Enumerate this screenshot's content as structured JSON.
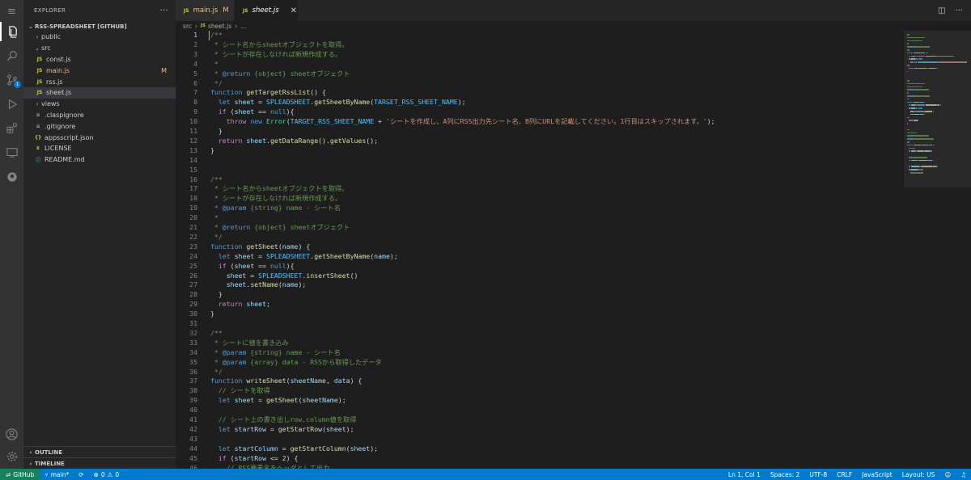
{
  "activity_bar": {
    "icons": [
      "menu-icon",
      "files-icon",
      "search-icon",
      "source-control-icon",
      "run-debug-icon",
      "extensions-icon",
      "remote-explorer-icon",
      "github-icon",
      "account-icon",
      "settings-gear-icon"
    ],
    "source_control_badge": "1"
  },
  "sidebar": {
    "title": "EXPLORER",
    "more_label": "···",
    "root_folder": "RSS-SPREADSHEET [GITHUB]",
    "tree": [
      {
        "label": "public",
        "type": "folder",
        "expanded": false,
        "depth": 0
      },
      {
        "label": "src",
        "type": "folder",
        "expanded": true,
        "depth": 0
      },
      {
        "label": "const.js",
        "type": "js",
        "depth": 1
      },
      {
        "label": "main.js",
        "type": "js",
        "depth": 1,
        "modified": "M"
      },
      {
        "label": "rss.js",
        "type": "js",
        "depth": 1
      },
      {
        "label": "sheet.js",
        "type": "js",
        "depth": 1,
        "selected": true
      },
      {
        "label": "views",
        "type": "folder",
        "expanded": false,
        "depth": 0
      },
      {
        "label": ".claspignore",
        "type": "cfg",
        "depth": 0
      },
      {
        "label": ".gitignore",
        "type": "cfg",
        "depth": 0
      },
      {
        "label": "appsscript.json",
        "type": "json",
        "depth": 0
      },
      {
        "label": "LICENSE",
        "type": "lic",
        "depth": 0
      },
      {
        "label": "README.md",
        "type": "md",
        "depth": 0
      }
    ],
    "outline_label": "OUTLINE",
    "timeline_label": "TIMELINE"
  },
  "tabs": [
    {
      "label": "main.js",
      "badge": "JS",
      "modified": "M",
      "active": false
    },
    {
      "label": "sheet.js",
      "badge": "JS",
      "active": true,
      "close": "✕"
    }
  ],
  "breadcrumb": {
    "folder": "src",
    "file_badge": "JS",
    "file": "sheet.js",
    "tail": "..."
  },
  "editor": {
    "current_line": 1,
    "lines": [
      [
        [
          "cm",
          "/**"
        ]
      ],
      [
        [
          "cm",
          " * シート名からsheetオブジェクトを取得。"
        ]
      ],
      [
        [
          "cm",
          " * シートが存在しなければ新規作成する。"
        ]
      ],
      [
        [
          "cm",
          " *"
        ]
      ],
      [
        [
          "cm",
          " * "
        ],
        [
          "tag",
          "@return"
        ],
        [
          "cm",
          " {object} sheetオブジェクト"
        ]
      ],
      [
        [
          "cm",
          " */"
        ]
      ],
      [
        [
          "kw",
          "function"
        ],
        [
          "p",
          " "
        ],
        [
          "fn",
          "getTargetRssList"
        ],
        [
          "p",
          "() {"
        ]
      ],
      [
        [
          "p",
          "  "
        ],
        [
          "kw",
          "let"
        ],
        [
          "p",
          " "
        ],
        [
          "var",
          "sheet"
        ],
        [
          "p",
          " = "
        ],
        [
          "const",
          "SPLEADSHEET"
        ],
        [
          "p",
          "."
        ],
        [
          "fn",
          "getSheetByName"
        ],
        [
          "p",
          "("
        ],
        [
          "const",
          "TARGET_RSS_SHEET_NAME"
        ],
        [
          "p",
          ");"
        ]
      ],
      [
        [
          "p",
          "  "
        ],
        [
          "ctl",
          "if"
        ],
        [
          "p",
          " ("
        ],
        [
          "var",
          "sheet"
        ],
        [
          "p",
          " == "
        ],
        [
          "kw",
          "null"
        ],
        [
          "p",
          "){"
        ]
      ],
      [
        [
          "p",
          "    "
        ],
        [
          "ctl",
          "throw"
        ],
        [
          "p",
          " "
        ],
        [
          "kw",
          "new"
        ],
        [
          "p",
          " "
        ],
        [
          "type",
          "Error"
        ],
        [
          "p",
          "("
        ],
        [
          "const",
          "TARGET_RSS_SHEET_NAME"
        ],
        [
          "p",
          " + "
        ],
        [
          "str",
          "'シートを作成し、A列にRSS出力先シート名、B列にURLを記載してください。1行目はスキップされます。'"
        ],
        [
          "p",
          ");"
        ]
      ],
      [
        [
          "p",
          "  }"
        ]
      ],
      [
        [
          "p",
          "  "
        ],
        [
          "ctl",
          "return"
        ],
        [
          "p",
          " "
        ],
        [
          "var",
          "sheet"
        ],
        [
          "p",
          "."
        ],
        [
          "fn",
          "getDataRange"
        ],
        [
          "p",
          "()."
        ],
        [
          "fn",
          "getValues"
        ],
        [
          "p",
          "();"
        ]
      ],
      [
        [
          "p",
          "}"
        ]
      ],
      [],
      [],
      [
        [
          "cm",
          "/**"
        ]
      ],
      [
        [
          "cm",
          " * シート名からsheetオブジェクトを取得。"
        ]
      ],
      [
        [
          "cm",
          " * シートが存在しなければ新規作成する。"
        ]
      ],
      [
        [
          "cm",
          " * "
        ],
        [
          "tag",
          "@param"
        ],
        [
          "cm",
          " {string} name - シート名"
        ]
      ],
      [
        [
          "cm",
          " *"
        ]
      ],
      [
        [
          "cm",
          " * "
        ],
        [
          "tag",
          "@return"
        ],
        [
          "cm",
          " {object} sheetオブジェクト"
        ]
      ],
      [
        [
          "cm",
          " */"
        ]
      ],
      [
        [
          "kw",
          "function"
        ],
        [
          "p",
          " "
        ],
        [
          "fn",
          "getSheet"
        ],
        [
          "p",
          "("
        ],
        [
          "var",
          "name"
        ],
        [
          "p",
          ") {"
        ]
      ],
      [
        [
          "p",
          "  "
        ],
        [
          "kw",
          "let"
        ],
        [
          "p",
          " "
        ],
        [
          "var",
          "sheet"
        ],
        [
          "p",
          " = "
        ],
        [
          "const",
          "SPLEADSHEET"
        ],
        [
          "p",
          "."
        ],
        [
          "fn",
          "getSheetByName"
        ],
        [
          "p",
          "("
        ],
        [
          "var",
          "name"
        ],
        [
          "p",
          ");"
        ]
      ],
      [
        [
          "p",
          "  "
        ],
        [
          "ctl",
          "if"
        ],
        [
          "p",
          " ("
        ],
        [
          "var",
          "sheet"
        ],
        [
          "p",
          " == "
        ],
        [
          "kw",
          "null"
        ],
        [
          "p",
          "){"
        ]
      ],
      [
        [
          "p",
          "    "
        ],
        [
          "var",
          "sheet"
        ],
        [
          "p",
          " = "
        ],
        [
          "const",
          "SPLEADSHEET"
        ],
        [
          "p",
          "."
        ],
        [
          "fn",
          "insertSheet"
        ],
        [
          "p",
          "()"
        ]
      ],
      [
        [
          "p",
          "    "
        ],
        [
          "var",
          "sheet"
        ],
        [
          "p",
          "."
        ],
        [
          "fn",
          "setName"
        ],
        [
          "p",
          "("
        ],
        [
          "var",
          "name"
        ],
        [
          "p",
          ");"
        ]
      ],
      [
        [
          "p",
          "  }"
        ]
      ],
      [
        [
          "p",
          "  "
        ],
        [
          "ctl",
          "return"
        ],
        [
          "p",
          " "
        ],
        [
          "var",
          "sheet"
        ],
        [
          "p",
          ";"
        ]
      ],
      [
        [
          "p",
          "}"
        ]
      ],
      [],
      [
        [
          "cm",
          "/**"
        ]
      ],
      [
        [
          "cm",
          " * シートに値を書き込み"
        ]
      ],
      [
        [
          "cm",
          " * "
        ],
        [
          "tag",
          "@param"
        ],
        [
          "cm",
          " {string} name - シート名"
        ]
      ],
      [
        [
          "cm",
          " * "
        ],
        [
          "tag",
          "@param"
        ],
        [
          "cm",
          " {array} data - RSSから取得したデータ"
        ]
      ],
      [
        [
          "cm",
          " */"
        ]
      ],
      [
        [
          "kw",
          "function"
        ],
        [
          "p",
          " "
        ],
        [
          "fn",
          "writeSheet"
        ],
        [
          "p",
          "("
        ],
        [
          "var",
          "sheetName"
        ],
        [
          "p",
          ", "
        ],
        [
          "var",
          "data"
        ],
        [
          "p",
          ") {"
        ]
      ],
      [
        [
          "p",
          "  "
        ],
        [
          "cm",
          "// シートを取得"
        ]
      ],
      [
        [
          "p",
          "  "
        ],
        [
          "kw",
          "let"
        ],
        [
          "p",
          " "
        ],
        [
          "var",
          "sheet"
        ],
        [
          "p",
          " = "
        ],
        [
          "fn",
          "getSheet"
        ],
        [
          "p",
          "("
        ],
        [
          "var",
          "sheetName"
        ],
        [
          "p",
          ");"
        ]
      ],
      [],
      [
        [
          "p",
          "  "
        ],
        [
          "cm",
          "// シート上の書き出しrow,column値を取得"
        ]
      ],
      [
        [
          "p",
          "  "
        ],
        [
          "kw",
          "let"
        ],
        [
          "p",
          " "
        ],
        [
          "var",
          "startRow"
        ],
        [
          "p",
          " = "
        ],
        [
          "fn",
          "getStartRow"
        ],
        [
          "p",
          "("
        ],
        [
          "var",
          "sheet"
        ],
        [
          "p",
          ");"
        ]
      ],
      [],
      [
        [
          "p",
          "  "
        ],
        [
          "kw",
          "let"
        ],
        [
          "p",
          " "
        ],
        [
          "var",
          "startColumn"
        ],
        [
          "p",
          " = "
        ],
        [
          "fn",
          "getStartColumn"
        ],
        [
          "p",
          "("
        ],
        [
          "var",
          "sheet"
        ],
        [
          "p",
          ");"
        ]
      ],
      [
        [
          "p",
          "  "
        ],
        [
          "ctl",
          "if"
        ],
        [
          "p",
          " ("
        ],
        [
          "var",
          "startRow"
        ],
        [
          "p",
          " <= 2) {"
        ]
      ],
      [
        [
          "p",
          "    "
        ],
        [
          "cm",
          "// RSS要素名をヘッダとして出力"
        ]
      ]
    ]
  },
  "statusbar": {
    "remote": "GitHub",
    "branch": "main*",
    "errors": "0",
    "warnings": "0",
    "position": "Ln 1, Col 1",
    "spaces": "Spaces: 2",
    "encoding": "UTF-8",
    "eol": "CRLF",
    "language": "JavaScript",
    "layout": "Layout: US"
  },
  "colors": {
    "accent": "#007acc",
    "remote": "#16825d",
    "modified": "#e2c08d",
    "comment": "#6a9955",
    "keyword": "#569cd6",
    "function": "#dcdcaa",
    "string": "#ce9178"
  }
}
